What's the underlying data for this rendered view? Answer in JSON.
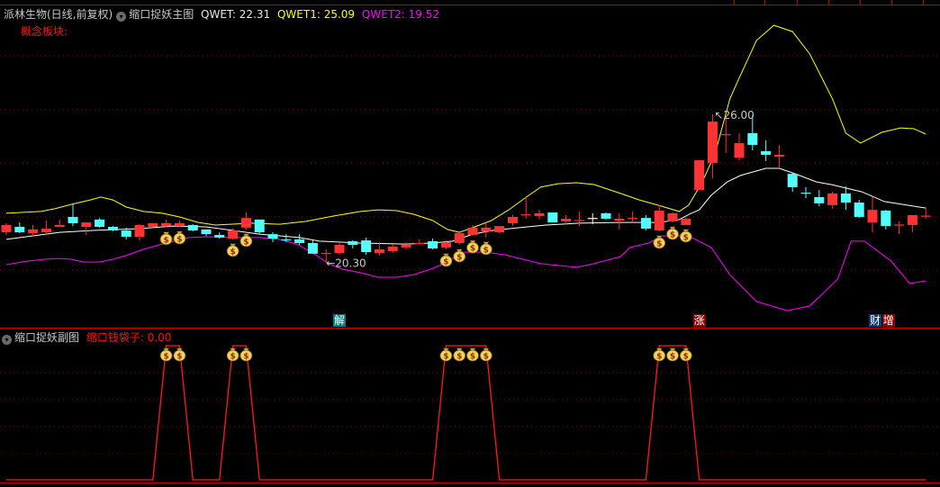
{
  "header": {
    "stock_name": "派林生物(日线,前复权)",
    "indicator_name": "缩口捉妖主图",
    "qwet_label": "QWET: 22.31",
    "qwet1_label": "QWET1: 25.09",
    "qwet2_label": "QWET2: 19.52",
    "concept_label": "概念板块:"
  },
  "sub_header": {
    "indicator_name": "缩口捉妖副图",
    "value_label": "缩口钱袋子: 0.00"
  },
  "icons": {
    "collapse": "chevron-down-circle-icon",
    "signal": "money-bag-icon"
  },
  "colors": {
    "up": "#ff3333",
    "down": "#54ffff",
    "flat": "#ffffff",
    "ma": "#ffffff",
    "upper": "#ffff00",
    "lower": "#ff00ff",
    "grid": "#8b0000",
    "separator": "#c00000"
  },
  "markers": [
    {
      "text": "解",
      "index": 25,
      "bg": "#007a7a"
    },
    {
      "text": "涨",
      "index": 52,
      "bg": "#8b0000"
    },
    {
      "text": "财",
      "index": 65.2,
      "bg": "#0b3a6e"
    },
    {
      "text": "增",
      "index": 66.2,
      "bg": "#8b0000"
    }
  ],
  "chart_data": {
    "type": "candlestick",
    "high_label": {
      "index": 53,
      "value": "26.00"
    },
    "low_label": {
      "index": 24,
      "value": "20.30"
    },
    "candles": [
      [
        21.48,
        21.83,
        21.38,
        21.76
      ],
      [
        21.69,
        21.86,
        21.45,
        21.48
      ],
      [
        21.45,
        21.76,
        21.31,
        21.59
      ],
      [
        21.48,
        21.93,
        21.41,
        21.62
      ],
      [
        21.69,
        21.97,
        21.69,
        21.76
      ],
      [
        22.07,
        22.59,
        21.72,
        21.83
      ],
      [
        21.69,
        21.86,
        21.38,
        21.86
      ],
      [
        21.97,
        22.03,
        21.66,
        21.69
      ],
      [
        21.69,
        21.72,
        21.52,
        21.55
      ],
      [
        21.55,
        21.66,
        21.21,
        21.31
      ],
      [
        21.31,
        21.79,
        21.17,
        21.76
      ],
      [
        21.69,
        21.83,
        21.66,
        21.83
      ],
      [
        21.72,
        21.97,
        21.66,
        21.83
      ],
      [
        21.72,
        21.93,
        21.69,
        21.83
      ],
      [
        21.76,
        21.79,
        21.52,
        21.55
      ],
      [
        21.59,
        21.59,
        21.34,
        21.41
      ],
      [
        21.38,
        21.48,
        21.24,
        21.28
      ],
      [
        21.24,
        21.62,
        21.21,
        21.55
      ],
      [
        21.66,
        22.24,
        21.59,
        22.03
      ],
      [
        21.97,
        21.97,
        21.41,
        21.48
      ],
      [
        21.41,
        21.48,
        21.1,
        21.24
      ],
      [
        21.21,
        21.41,
        21.1,
        21.17
      ],
      [
        21.21,
        21.41,
        21.0,
        21.07
      ],
      [
        21.07,
        21.17,
        20.66,
        20.66
      ],
      [
        20.66,
        20.83,
        20.3,
        20.69
      ],
      [
        20.69,
        21.07,
        20.62,
        21.0
      ],
      [
        21.14,
        21.17,
        20.86,
        21.0
      ],
      [
        21.17,
        21.28,
        20.62,
        20.72
      ],
      [
        20.69,
        21.1,
        20.59,
        20.83
      ],
      [
        20.76,
        21.03,
        20.69,
        20.93
      ],
      [
        20.9,
        21.1,
        20.83,
        21.0
      ],
      [
        21.03,
        21.21,
        21.03,
        21.07
      ],
      [
        21.14,
        21.24,
        20.83,
        20.86
      ],
      [
        20.9,
        21.17,
        20.83,
        21.1
      ],
      [
        21.07,
        21.52,
        21.0,
        21.45
      ],
      [
        21.38,
        21.76,
        21.34,
        21.66
      ],
      [
        21.52,
        21.83,
        21.28,
        21.66
      ],
      [
        21.48,
        21.72,
        21.45,
        21.72
      ],
      [
        21.83,
        22.14,
        21.72,
        22.07
      ],
      [
        22.14,
        22.83,
        22.0,
        22.17
      ],
      [
        22.1,
        22.34,
        21.97,
        22.21
      ],
      [
        22.24,
        22.24,
        21.86,
        21.86
      ],
      [
        21.9,
        22.14,
        21.79,
        22.0
      ],
      [
        21.93,
        22.28,
        21.72,
        21.95
      ],
      [
        22.03,
        22.21,
        21.79,
        22.03
      ],
      [
        22.21,
        22.24,
        21.97,
        22.0
      ],
      [
        21.93,
        22.21,
        21.59,
        22.0
      ],
      [
        22.0,
        22.28,
        21.86,
        22.03
      ],
      [
        22.03,
        22.14,
        21.55,
        21.62
      ],
      [
        21.55,
        22.52,
        21.52,
        22.31
      ],
      [
        21.9,
        22.24,
        21.86,
        22.21
      ],
      [
        21.76,
        22.14,
        21.76,
        22.0
      ],
      [
        23.1,
        24.24,
        23.1,
        24.24
      ],
      [
        24.14,
        26.0,
        23.55,
        25.72
      ],
      [
        25.21,
        25.83,
        24.52,
        25.24
      ],
      [
        24.34,
        25.28,
        24.24,
        24.9
      ],
      [
        25.28,
        25.97,
        24.62,
        24.83
      ],
      [
        24.59,
        25.0,
        24.21,
        24.45
      ],
      [
        24.38,
        24.83,
        23.97,
        24.45
      ],
      [
        23.72,
        23.76,
        23.03,
        23.21
      ],
      [
        23.0,
        23.21,
        22.79,
        22.98
      ],
      [
        22.83,
        23.1,
        22.48,
        22.59
      ],
      [
        22.52,
        23.03,
        22.38,
        22.97
      ],
      [
        22.97,
        23.24,
        22.34,
        22.62
      ],
      [
        22.62,
        22.72,
        22.03,
        22.07
      ],
      [
        21.86,
        22.83,
        21.48,
        22.34
      ],
      [
        22.31,
        22.34,
        21.59,
        21.72
      ],
      [
        21.76,
        21.9,
        21.41,
        21.78
      ],
      [
        21.76,
        22.14,
        21.48,
        22.14
      ],
      [
        22.1,
        22.45,
        22.0,
        22.12
      ]
    ],
    "series": [
      {
        "name": "QWET",
        "points": [
          [
            0,
            21.21
          ],
          [
            4,
            21.48
          ],
          [
            6.5,
            21.55
          ],
          [
            10,
            21.62
          ],
          [
            12.5,
            21.72
          ],
          [
            15,
            21.69
          ],
          [
            17,
            21.55
          ],
          [
            19,
            21.41
          ],
          [
            22,
            21.28
          ],
          [
            23.5,
            21.14
          ],
          [
            26.5,
            21.07
          ],
          [
            30,
            21.03
          ],
          [
            32,
            21.07
          ],
          [
            33.5,
            21.14
          ],
          [
            35,
            21.41
          ],
          [
            36.5,
            21.55
          ],
          [
            38.5,
            21.66
          ],
          [
            40.5,
            21.76
          ],
          [
            43,
            21.83
          ],
          [
            46,
            21.86
          ],
          [
            49,
            21.86
          ],
          [
            50.5,
            21.97
          ],
          [
            51.4,
            22.21
          ],
          [
            52,
            22.34
          ],
          [
            52.9,
            22.9
          ],
          [
            54.1,
            23.41
          ],
          [
            55.1,
            23.66
          ],
          [
            57,
            23.93
          ],
          [
            58,
            23.93
          ],
          [
            59,
            23.76
          ],
          [
            60.8,
            23.41
          ],
          [
            61.9,
            23.31
          ],
          [
            64.2,
            23.03
          ],
          [
            65.9,
            22.66
          ],
          [
            67.6,
            22.52
          ],
          [
            69,
            22.41
          ]
        ]
      },
      {
        "name": "QWET1",
        "points": [
          [
            0,
            22.21
          ],
          [
            2.6,
            22.28
          ],
          [
            3.6,
            22.38
          ],
          [
            4.9,
            22.55
          ],
          [
            6.3,
            22.72
          ],
          [
            7.1,
            22.83
          ],
          [
            8,
            22.72
          ],
          [
            9,
            22.45
          ],
          [
            10.3,
            22.28
          ],
          [
            11.7,
            22.21
          ],
          [
            13,
            22.07
          ],
          [
            14.4,
            21.86
          ],
          [
            15.7,
            21.76
          ],
          [
            18.4,
            21.83
          ],
          [
            20.5,
            21.79
          ],
          [
            22.5,
            21.9
          ],
          [
            24.5,
            22.1
          ],
          [
            26.6,
            22.28
          ],
          [
            27.9,
            22.34
          ],
          [
            29.3,
            22.31
          ],
          [
            30.6,
            22.17
          ],
          [
            32,
            21.93
          ],
          [
            33.1,
            21.59
          ],
          [
            34,
            21.48
          ],
          [
            35,
            21.66
          ],
          [
            36.4,
            21.93
          ],
          [
            37.7,
            22.34
          ],
          [
            39.1,
            22.86
          ],
          [
            40.1,
            23.21
          ],
          [
            41.4,
            23.34
          ],
          [
            42.8,
            23.38
          ],
          [
            44.1,
            23.31
          ],
          [
            46.1,
            22.97
          ],
          [
            47.5,
            22.72
          ],
          [
            48.9,
            22.52
          ],
          [
            50.5,
            22.28
          ],
          [
            51.2,
            22.52
          ],
          [
            52.2,
            23.38
          ],
          [
            53.2,
            24.52
          ],
          [
            54.3,
            26.59
          ],
          [
            54.9,
            27.28
          ],
          [
            56.3,
            28.83
          ],
          [
            57.6,
            29.41
          ],
          [
            59,
            29.17
          ],
          [
            60.3,
            28.31
          ],
          [
            62,
            26.59
          ],
          [
            63,
            25.28
          ],
          [
            64.1,
            24.9
          ],
          [
            65.7,
            25.31
          ],
          [
            67.1,
            25.48
          ],
          [
            68.1,
            25.45
          ],
          [
            69,
            25.24
          ]
        ]
      },
      {
        "name": "QWET2",
        "points": [
          [
            0,
            20.24
          ],
          [
            1.6,
            20.38
          ],
          [
            2.9,
            20.45
          ],
          [
            3.9,
            20.48
          ],
          [
            4.9,
            20.45
          ],
          [
            5.8,
            20.34
          ],
          [
            7,
            20.34
          ],
          [
            8,
            20.45
          ],
          [
            9,
            20.59
          ],
          [
            10.3,
            20.83
          ],
          [
            11.7,
            21.03
          ],
          [
            13.7,
            21.28
          ],
          [
            15.1,
            21.31
          ],
          [
            17.1,
            21.28
          ],
          [
            19.1,
            21.28
          ],
          [
            20.5,
            21.21
          ],
          [
            21.8,
            21.03
          ],
          [
            23.2,
            20.62
          ],
          [
            24.2,
            20.28
          ],
          [
            25.2,
            20.07
          ],
          [
            26.6,
            19.93
          ],
          [
            27.9,
            19.76
          ],
          [
            29.3,
            19.76
          ],
          [
            30.6,
            19.86
          ],
          [
            32,
            20.1
          ],
          [
            33.3,
            20.38
          ],
          [
            34,
            20.72
          ],
          [
            36,
            20.72
          ],
          [
            37.4,
            20.62
          ],
          [
            40.1,
            20.28
          ],
          [
            42.8,
            20.14
          ],
          [
            44.1,
            20.28
          ],
          [
            46.1,
            20.55
          ],
          [
            46.8,
            20.9
          ],
          [
            48.2,
            21.07
          ],
          [
            49.2,
            21.34
          ],
          [
            51.2,
            21.34
          ],
          [
            52.9,
            20.9
          ],
          [
            54.3,
            19.86
          ],
          [
            56.3,
            18.83
          ],
          [
            58.6,
            18.48
          ],
          [
            60.3,
            18.66
          ],
          [
            62.4,
            19.69
          ],
          [
            63.4,
            21.14
          ],
          [
            64.4,
            21.14
          ],
          [
            66.4,
            20.38
          ],
          [
            67.8,
            19.52
          ],
          [
            69,
            19.62
          ]
        ]
      }
    ],
    "signal_indices": [
      12,
      13,
      17,
      18,
      33,
      34,
      35,
      36,
      49,
      50,
      51
    ],
    "sub_series": {
      "name": "缩口钱袋子",
      "range": [
        0,
        1
      ]
    }
  }
}
